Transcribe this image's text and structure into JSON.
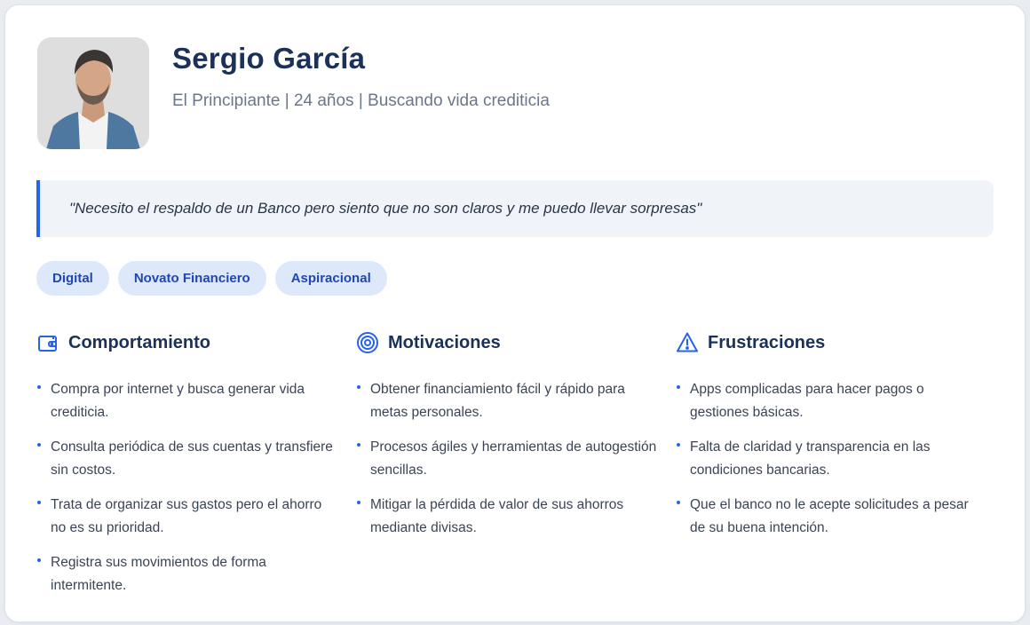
{
  "persona": {
    "name": "Sergio García",
    "subtitle": "El Principiante | 24 años | Buscando vida crediticia",
    "quote": "\"Necesito el respaldo de un Banco pero siento que no son claros y me puedo llevar sorpresas\"",
    "tags": [
      "Digital",
      "Novato Financiero",
      "Aspiracional"
    ]
  },
  "sections": {
    "behavior": {
      "title": "Comportamiento",
      "icon": "wallet-icon",
      "items": [
        "Compra por internet y busca generar vida crediticia.",
        "Consulta periódica de sus cuentas y transfiere sin costos.",
        "Trata de organizar sus gastos pero el ahorro no es su prioridad.",
        "Registra sus movimientos de forma intermitente."
      ]
    },
    "motivations": {
      "title": "Motivaciones",
      "icon": "target-icon",
      "items": [
        "Obtener financiamiento fácil y rápido para metas personales.",
        "Procesos ágiles y herramientas de autogestión sencillas.",
        "Mitigar la pérdida de valor de sus ahorros mediante divisas."
      ]
    },
    "frustrations": {
      "title": "Frustraciones",
      "icon": "warning-icon",
      "items": [
        "Apps complicadas para hacer pagos o gestiones básicas.",
        "Falta de claridad y transparencia en las condiciones bancarias.",
        "Que el banco no le acepte solicitudes a pesar de su buena intención."
      ]
    }
  },
  "colors": {
    "accent": "#2563eb",
    "title": "#1b3157",
    "tag_bg": "#dde8fb",
    "tag_text": "#1f47b3",
    "quote_bg": "#f0f4f9"
  }
}
